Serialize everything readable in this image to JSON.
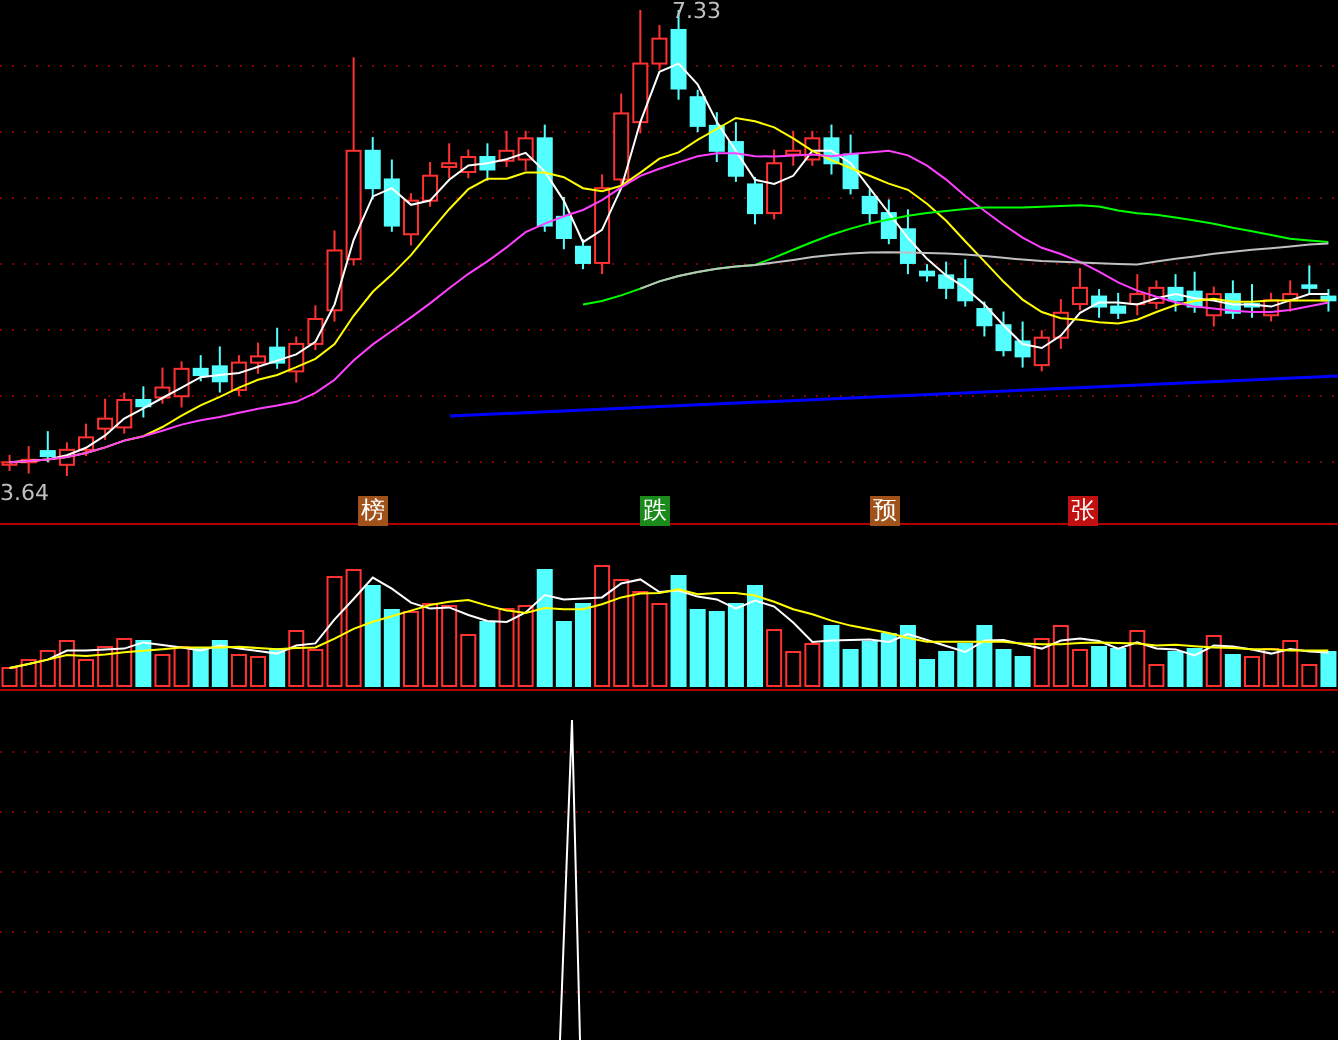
{
  "price_pane": {
    "high_label": "7.33",
    "low_label": "3.64",
    "markers": [
      {
        "text": "榜",
        "color": "#a0521a"
      },
      {
        "text": "跌",
        "color": "#1a8a1a"
      },
      {
        "text": "预",
        "color": "#a0521a"
      },
      {
        "text": "张",
        "color": "#c01010"
      }
    ]
  }
}
